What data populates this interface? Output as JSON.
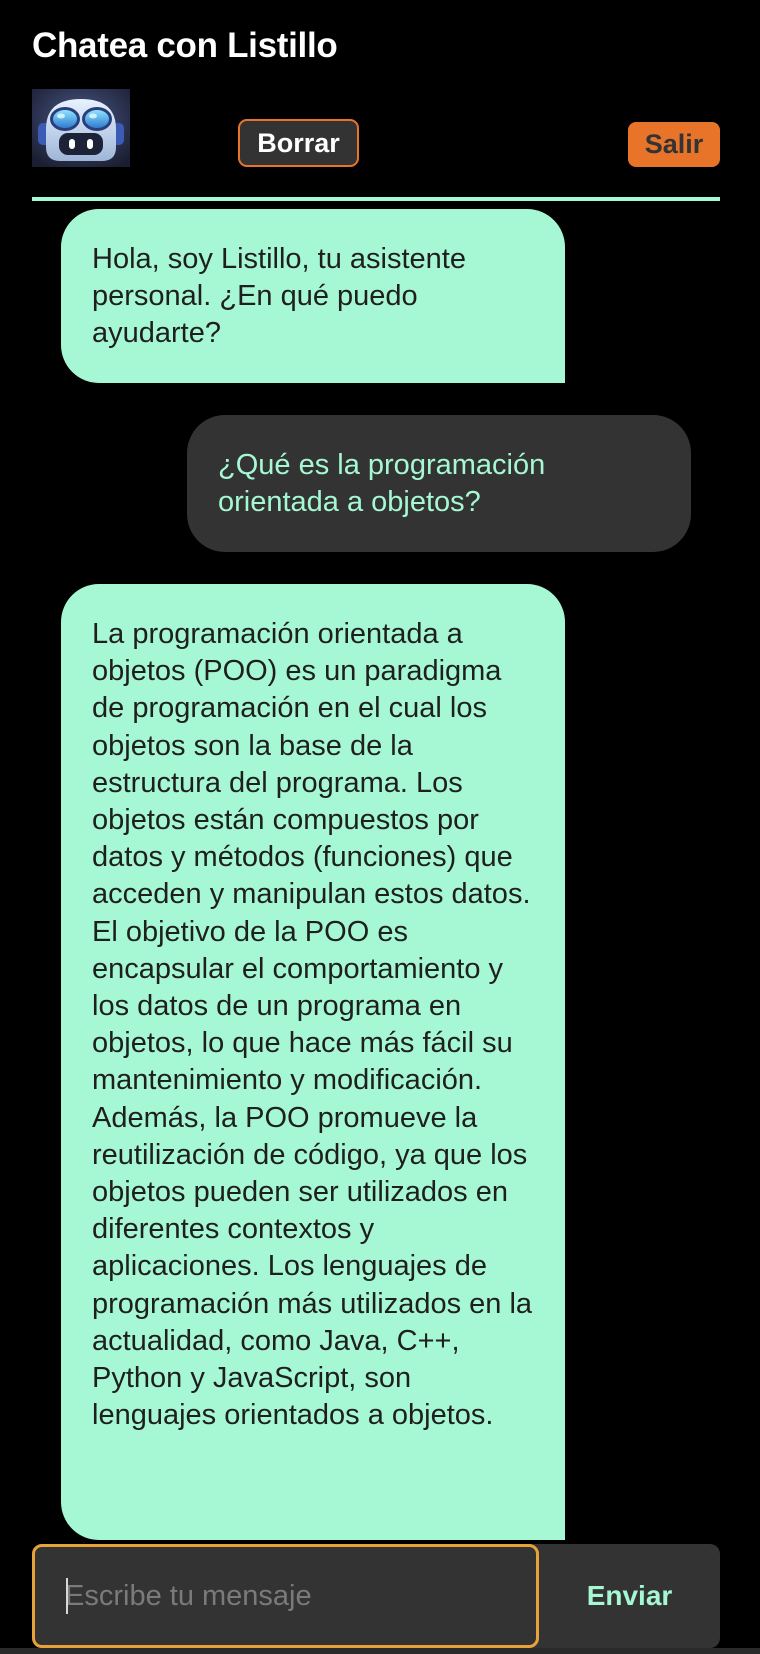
{
  "header": {
    "title": "Chatea con Listillo",
    "borrar_label": "Borrar",
    "salir_label": "Salir",
    "avatar_icon": "robot-avatar-icon"
  },
  "messages": [
    {
      "role": "bot",
      "text": "Hola, soy Listillo, tu asistente personal. ¿En qué puedo ayudarte?"
    },
    {
      "role": "user",
      "text": "¿Qué es la programación orientada a objetos?"
    },
    {
      "role": "bot",
      "text": "La programación orientada a objetos (POO) es un paradigma de programación en el cual los objetos son la base de la estructura del programa. Los objetos están compuestos por datos y métodos (funciones) que acceden y manipulan estos datos. El objetivo de la POO es encapsular el comportamiento y los datos de un programa en objetos, lo que hace más fácil su mantenimiento y modificación. Además, la POO promueve la reutilización de código, ya que los objetos pueden ser utilizados en diferentes contextos y aplicaciones. Los lenguajes de programación más utilizados en la actualidad, como Java, C++, Python y JavaScript, son lenguajes orientados a objetos."
    }
  ],
  "composer": {
    "placeholder": "Escribe tu mensaje",
    "value": "",
    "send_label": "Enviar"
  },
  "colors": {
    "background": "#000000",
    "mint": "#a5f8d3",
    "dark_gray": "#333333",
    "orange": "#e8742a",
    "input_border": "#e8a23a"
  }
}
